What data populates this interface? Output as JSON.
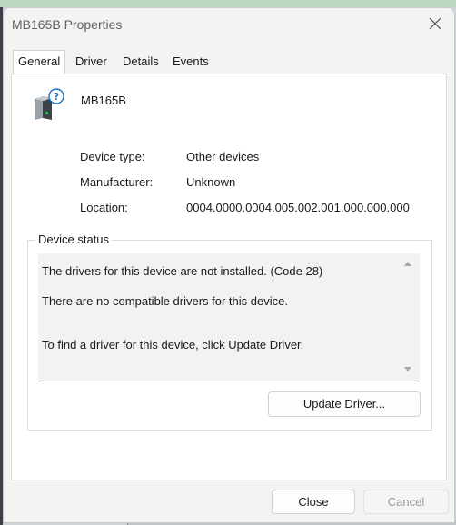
{
  "window": {
    "title": "MB165B Properties"
  },
  "tabs": [
    {
      "label": "General",
      "active": true
    },
    {
      "label": "Driver",
      "active": false
    },
    {
      "label": "Details",
      "active": false
    },
    {
      "label": "Events",
      "active": false
    }
  ],
  "device": {
    "name": "MB165B",
    "icon": "unknown-device-icon",
    "properties": [
      {
        "label": "Device type:",
        "value": "Other devices"
      },
      {
        "label": "Manufacturer:",
        "value": "Unknown"
      },
      {
        "label": "Location:",
        "value": "0004.0000.0004.005.002.001.000.000.000"
      }
    ]
  },
  "status": {
    "legend": "Device status",
    "lines": [
      "The drivers for this device are not installed. (Code 28)",
      "There are no compatible drivers for this device.",
      "To find a driver for this device, click Update Driver."
    ],
    "update_button": "Update Driver..."
  },
  "footer": {
    "close_label": "Close",
    "cancel_label": "Cancel"
  },
  "colors": {
    "accent_green": "#26b34a",
    "help_blue": "#1a73c8"
  }
}
